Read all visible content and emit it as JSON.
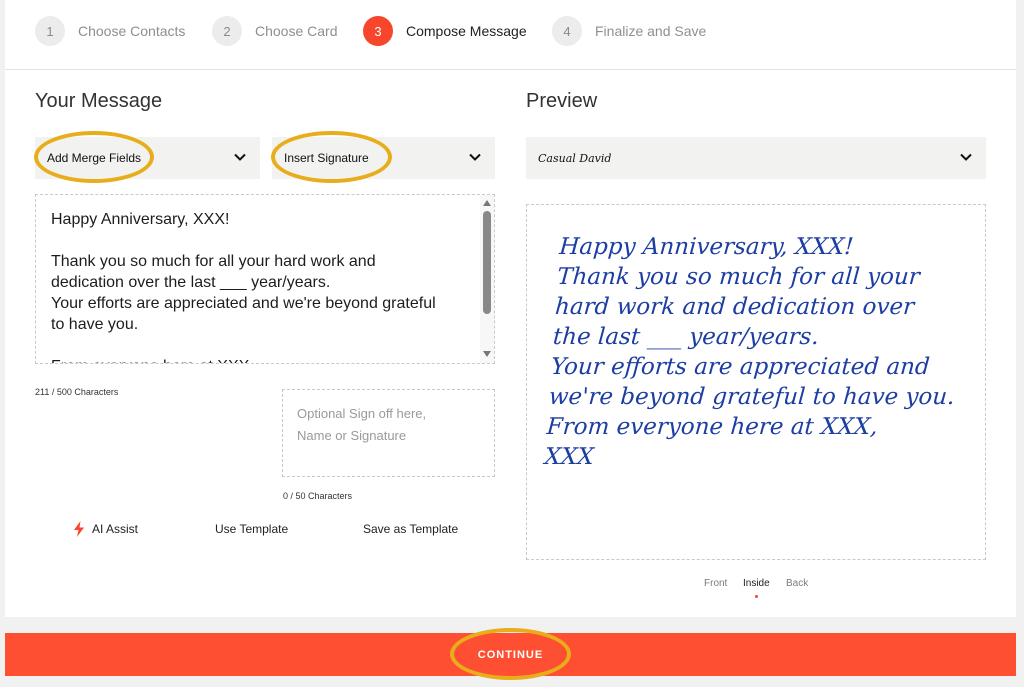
{
  "steps": [
    {
      "number": "1",
      "label": "Choose Contacts"
    },
    {
      "number": "2",
      "label": "Choose Card"
    },
    {
      "number": "3",
      "label": "Compose Message"
    },
    {
      "number": "4",
      "label": "Finalize and Save"
    }
  ],
  "message_section": {
    "title": "Your Message",
    "merge_fields_label": "Add Merge Fields",
    "insert_signature_label": "Insert Signature",
    "message_text": "Happy Anniversary, XXX!\n\nThank you so much for all your hard work and dedication over the last ___ year/years.\nYour efforts are appreciated and we're beyond grateful to have you.\n\nFrom everyone here at XXX,",
    "char_count": "211 / 500 Characters",
    "signoff_placeholder": "Optional Sign off here,\nName or Signature",
    "signoff_char_count": "0 / 50 Characters"
  },
  "actions": {
    "ai_assist": "AI Assist",
    "use_template": "Use Template",
    "save_template": "Save as Template"
  },
  "preview_section": {
    "title": "Preview",
    "font_select": "Casual David",
    "preview_text": "Happy Anniversary, XXX!\nThank you so much for all your\nhard work and dedication over\nthe last ___ year/years.\nYour efforts are appreciated and\nwe're beyond grateful to have you.\nFrom everyone here at XXX,\nXXX",
    "tabs": [
      "Front",
      "Inside",
      "Back"
    ],
    "active_tab": "Inside"
  },
  "continue_label": "CONTINUE",
  "colors": {
    "accent": "#ff4f32",
    "highlight": "#e8ad1a",
    "preview_ink": "#1c3ea2"
  },
  "icons": [
    "chevron-down-icon",
    "lightning-bolt-icon",
    "scroll-up-arrow-icon",
    "scroll-down-arrow-icon"
  ]
}
